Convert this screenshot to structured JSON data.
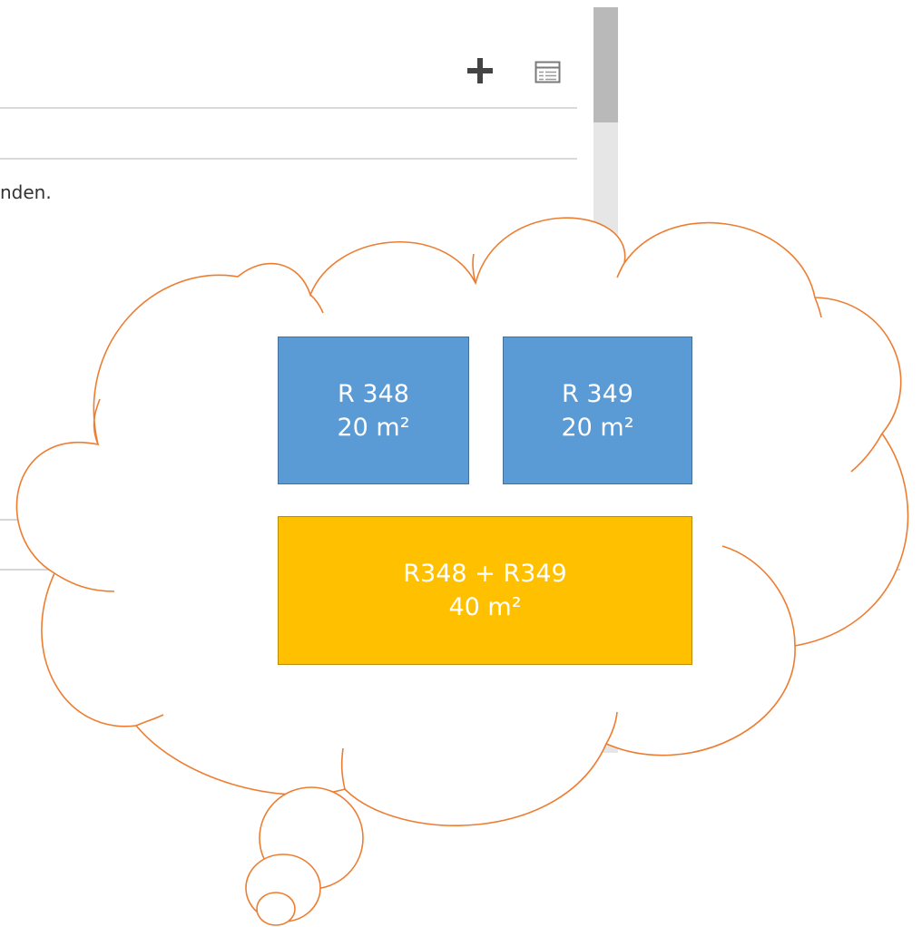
{
  "toolbar": {
    "add_icon": "plus-icon",
    "view_icon": "list-view-icon"
  },
  "list": {
    "partial_text": "nden."
  },
  "thought_bubble": {
    "stroke_color": "#ed7d31",
    "rooms": [
      {
        "name": "R 348",
        "area": "20 m²",
        "color": "#5b9bd5"
      },
      {
        "name": "R 349",
        "area": "20 m²",
        "color": "#5b9bd5"
      }
    ],
    "merged": {
      "name": "R348 + R349",
      "area": "40 m²",
      "color": "#ffc000"
    }
  }
}
